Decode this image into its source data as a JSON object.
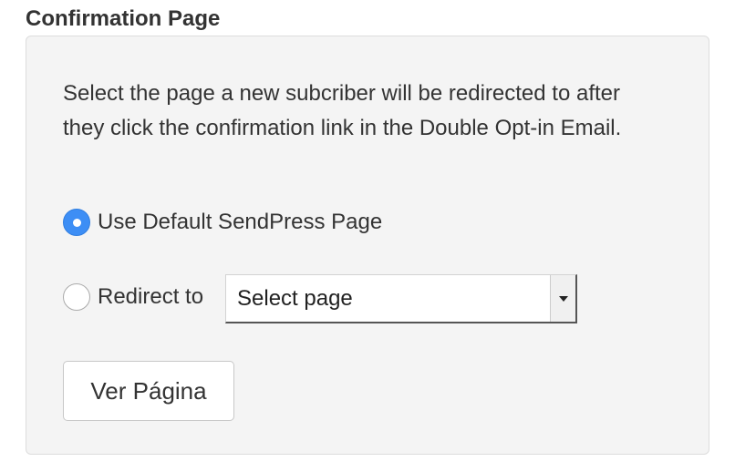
{
  "section": {
    "title": "Confirmation Page"
  },
  "description": "Select the page a new subcriber will be redirected to after they click the confirmation link in the Double Opt-in Email.",
  "options": {
    "default": {
      "label": "Use Default SendPress Page",
      "checked": true
    },
    "redirect": {
      "label": "Redirect to",
      "checked": false
    }
  },
  "select": {
    "value": "Select page",
    "arrow_icon": "caret-down-icon"
  },
  "button": {
    "label": "Ver Página"
  },
  "colors": {
    "radio_checked": "#3d8ef5",
    "panel_background": "#f4f4f4"
  }
}
